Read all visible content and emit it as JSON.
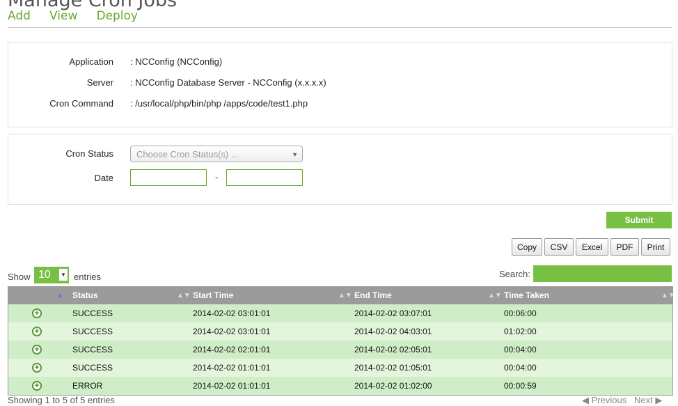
{
  "page": {
    "title": "Manage Cron Jobs"
  },
  "nav": {
    "items": [
      "Add",
      "View",
      "Deploy"
    ]
  },
  "details": {
    "application_label": "Application",
    "application_value": ": NCConfig (NCConfig)",
    "server_label": "Server",
    "server_value": ": NCConfig Database Server - NCConfig (x.x.x.x)",
    "command_label": "Cron Command",
    "command_value": ": /usr/local/php/bin/php /apps/code/test1.php"
  },
  "filters": {
    "status_label": "Cron Status",
    "status_placeholder": "Choose Cron Status(s) ...",
    "date_label": "Date",
    "date_separator": "-",
    "date_from": "",
    "date_to": ""
  },
  "submit_label": "Submit",
  "export_buttons": [
    "Copy",
    "CSV",
    "Excel",
    "PDF",
    "Print"
  ],
  "length": {
    "show_label": "Show",
    "value": "10",
    "entries_label": "entries"
  },
  "search": {
    "label": "Search:",
    "value": ""
  },
  "table": {
    "columns": [
      "Status",
      "Start Time",
      "End Time",
      "Time Taken"
    ],
    "rows": [
      [
        "SUCCESS",
        "2014-02-02 03:01:01",
        "2014-02-02 03:07:01",
        "00:06:00"
      ],
      [
        "SUCCESS",
        "2014-02-02 03:01:01",
        "2014-02-02 04:03:01",
        "01:02:00"
      ],
      [
        "SUCCESS",
        "2014-02-02 02:01:01",
        "2014-02-02 02:05:01",
        "00:04:00"
      ],
      [
        "SUCCESS",
        "2014-02-02 01:01:01",
        "2014-02-02 01:05:01",
        "00:04:00"
      ],
      [
        "ERROR",
        "2014-02-02 01:01:01",
        "2014-02-02 01:02:00",
        "00:00:59"
      ]
    ]
  },
  "info": "Showing 1 to 5 of 5 entries",
  "pager": {
    "previous": "Previous",
    "next": "Next"
  },
  "colors": {
    "accent": "#78c043",
    "row_odd": "#cfeec7",
    "row_even": "#e3f6dc",
    "header": "#9b9b9b"
  },
  "icons": {
    "expand_row": "plus-circle-icon"
  }
}
